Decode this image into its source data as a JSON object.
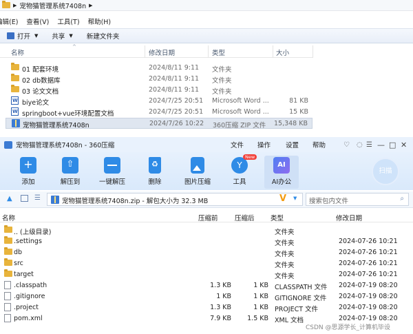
{
  "explorer": {
    "menu": [
      "编辑(E)",
      "查看(V)",
      "工具(T)",
      "帮助(H)"
    ],
    "breadcrumb": "宠物猫管理系统7408n",
    "toolbar": {
      "open": "打开",
      "share": "共享",
      "new_folder": "新建文件夹"
    },
    "columns": {
      "name": "名称",
      "date": "修改日期",
      "type": "类型",
      "size": "大小"
    },
    "rows": [
      {
        "icon": "folder-icon",
        "name": "01 配套环境",
        "date": "2024/8/11 9:11",
        "type": "文件夹",
        "size": ""
      },
      {
        "icon": "folder-icon",
        "name": "02 db数据库",
        "date": "2024/8/11 9:11",
        "type": "文件夹",
        "size": ""
      },
      {
        "icon": "folder-icon",
        "name": "03 论文文档",
        "date": "2024/8/11 9:11",
        "type": "文件夹",
        "size": ""
      },
      {
        "icon": "word-doc-icon",
        "name": "biye论文",
        "date": "2024/7/25 20:51",
        "type": "Microsoft Word ...",
        "size": "81 KB"
      },
      {
        "icon": "word-doc-icon",
        "name": "springboot+vue环境配置文档",
        "date": "2024/7/25 20:51",
        "type": "Microsoft Word ...",
        "size": "15 KB"
      },
      {
        "icon": "zip-icon",
        "name": "宠物猫管理系统7408n",
        "date": "2024/7/26 10:22",
        "type": "360压缩 ZIP 文件",
        "size": "15,348 KB"
      }
    ]
  },
  "zip": {
    "title": "宠物猫管理系统7408n - 360压缩",
    "menu": [
      "文件",
      "操作",
      "设置",
      "帮助"
    ],
    "ribbon": [
      {
        "label": "添加",
        "icon": "add-icon",
        "color": "#2f8be6"
      },
      {
        "label": "解压到",
        "icon": "extract-to-icon",
        "color": "#2f8be6"
      },
      {
        "label": "一键解压",
        "icon": "one-click-extract-icon",
        "color": "#2f8be6"
      },
      {
        "label": "删除",
        "icon": "delete-icon",
        "color": "#2f8be6"
      },
      {
        "label": "图片压缩",
        "icon": "image-compress-icon",
        "color": "#2f8be6"
      },
      {
        "label": "工具",
        "icon": "tools-icon",
        "color": "#2f8be6"
      },
      {
        "label": "AI办公",
        "icon": "ai-office-icon",
        "color": "#4f7ff2"
      }
    ],
    "new_badge": "New",
    "scan_label": "扫描",
    "path_text": "宠物猫管理系统7408n.zip - 解包大小为 32.3 MB",
    "search_placeholder": "搜索包内文件",
    "columns": {
      "name": "名称",
      "compressed": "压缩前",
      "after": "压缩后",
      "type": "类型",
      "date": "修改日期"
    },
    "rows": [
      {
        "icon": "folder-icon",
        "name": ".. (上级目录)",
        "before": "",
        "after": "",
        "type": "文件夹",
        "date": ""
      },
      {
        "icon": "folder-icon",
        "name": ".settings",
        "before": "",
        "after": "",
        "type": "文件夹",
        "date": "2024-07-26 10:21"
      },
      {
        "icon": "folder-icon",
        "name": "db",
        "before": "",
        "after": "",
        "type": "文件夹",
        "date": "2024-07-26 10:21"
      },
      {
        "icon": "folder-icon",
        "name": "src",
        "before": "",
        "after": "",
        "type": "文件夹",
        "date": "2024-07-26 10:21"
      },
      {
        "icon": "folder-icon",
        "name": "target",
        "before": "",
        "after": "",
        "type": "文件夹",
        "date": "2024-07-26 10:21"
      },
      {
        "icon": "file-icon",
        "name": ".classpath",
        "before": "1.3 KB",
        "after": "1 KB",
        "type": "CLASSPATH 文件",
        "date": "2024-07-19 08:20"
      },
      {
        "icon": "file-icon",
        "name": ".gitignore",
        "before": "1 KB",
        "after": "1 KB",
        "type": "GITIGNORE 文件",
        "date": "2024-07-19 08:20"
      },
      {
        "icon": "file-icon",
        "name": ".project",
        "before": "1.3 KB",
        "after": "1 KB",
        "type": "PROJECT 文件",
        "date": "2024-07-19 08:20"
      },
      {
        "icon": "file-icon",
        "name": "pom.xml",
        "before": "7.9 KB",
        "after": "1.5 KB",
        "type": "XML 文档",
        "date": "2024-07-19 08:20"
      }
    ]
  },
  "watermark": "CSDN @思源学长_计算机毕设"
}
